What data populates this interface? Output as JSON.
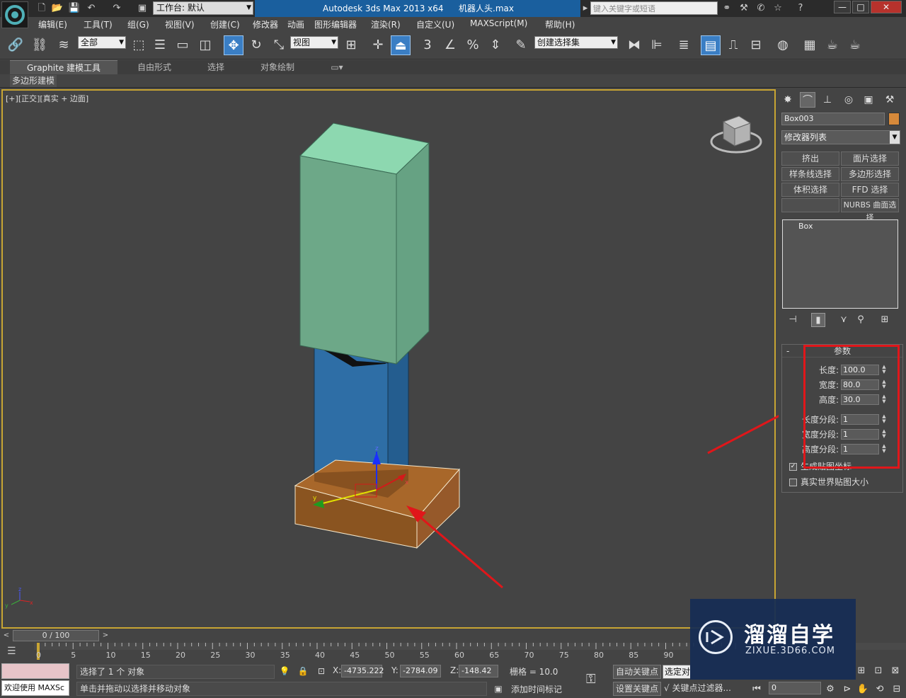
{
  "title_bar": {
    "workspace_label": "工作台: 默认",
    "app_name": "Autodesk 3ds Max  2013 x64",
    "file_name": "机器人头.max",
    "search_placeholder": "键入关键字或短语",
    "minimize": "—",
    "maximize": "□",
    "close": "✕"
  },
  "menu": [
    "编辑(E)",
    "工具(T)",
    "组(G)",
    "视图(V)",
    "创建(C)",
    "修改器",
    "动画",
    "图形编辑器",
    "渲染(R)",
    "自定义(U)",
    "MAXScript(M)",
    "帮助(H)"
  ],
  "toolbar": {
    "selection_filter": "全部",
    "ref_coord": "视图",
    "named_selection": "创建选择集",
    "snap_label": "3"
  },
  "ribbon": {
    "tabs": [
      "Graphite 建模工具",
      "自由形式",
      "选择",
      "对象绘制"
    ],
    "sub_tab": "多边形建模"
  },
  "viewport": {
    "label_bracket_plus": "[+]",
    "label_view": "[正交]",
    "label_shading": "[真实 + 边面]",
    "gizmo_axes": {
      "x": "x",
      "y": "y",
      "z": "z"
    },
    "world_axes": {
      "x": "x",
      "y": "y",
      "z": "z"
    }
  },
  "command_panel": {
    "object_name": "Box003",
    "object_color": "#d6893a",
    "modifier_list": "修改器列表",
    "modifier_buttons": [
      "挤出",
      "面片选择",
      "样条线选择",
      "多边形选择",
      "体积选择",
      "FFD 选择",
      "",
      "NURBS 曲面选择"
    ],
    "stack_item": "Box",
    "params_title": "参数",
    "params_collapse": "-",
    "params": [
      {
        "label": "长度:",
        "value": "100.0"
      },
      {
        "label": "宽度:",
        "value": "80.0"
      },
      {
        "label": "高度:",
        "value": "30.0"
      },
      {
        "label": "长度分段:",
        "value": "1"
      },
      {
        "label": "宽度分段:",
        "value": "1"
      },
      {
        "label": "高度分段:",
        "value": "1"
      }
    ],
    "checkboxes": [
      {
        "label": "生成贴图坐标",
        "checked": true
      },
      {
        "label": "真实世界贴图大小",
        "checked": false
      }
    ]
  },
  "timeline": {
    "frame_display": "0 / 100",
    "ticks": [
      "0",
      "5",
      "10",
      "15",
      "20",
      "25",
      "30",
      "35",
      "40",
      "45",
      "50",
      "55",
      "60",
      "65",
      "70",
      "75",
      "80",
      "85",
      "90"
    ]
  },
  "status": {
    "welcome": "欢迎使用 MAXSc",
    "selection_info": "选择了 1 个 对象",
    "prompt": "单击并拖动以选择并移动对象",
    "x_label": "X:",
    "x_value": "-4735.222",
    "y_label": "Y:",
    "y_value": "-2784.09",
    "z_label": "Z:",
    "z_value": "-148.42",
    "grid": "栅格 = 10.0",
    "add_time_tag": "添加时间标记",
    "auto_key": "自动关键点",
    "set_key": "设置关键点",
    "selected_dropdown": "选定对象",
    "key_filters": "关键点过滤器...",
    "frame_field": "0"
  },
  "watermark": {
    "name": "溜溜自学",
    "url": "ZIXUE.3D66.COM"
  },
  "colors": {
    "title_accent": "#1a5f9e",
    "viewport_border": "#c8a533",
    "annotation_red": "#e0161a",
    "top_box": "#8dd8b0",
    "middle_box": "#2e6ea6",
    "base_box": "#a8672a"
  }
}
